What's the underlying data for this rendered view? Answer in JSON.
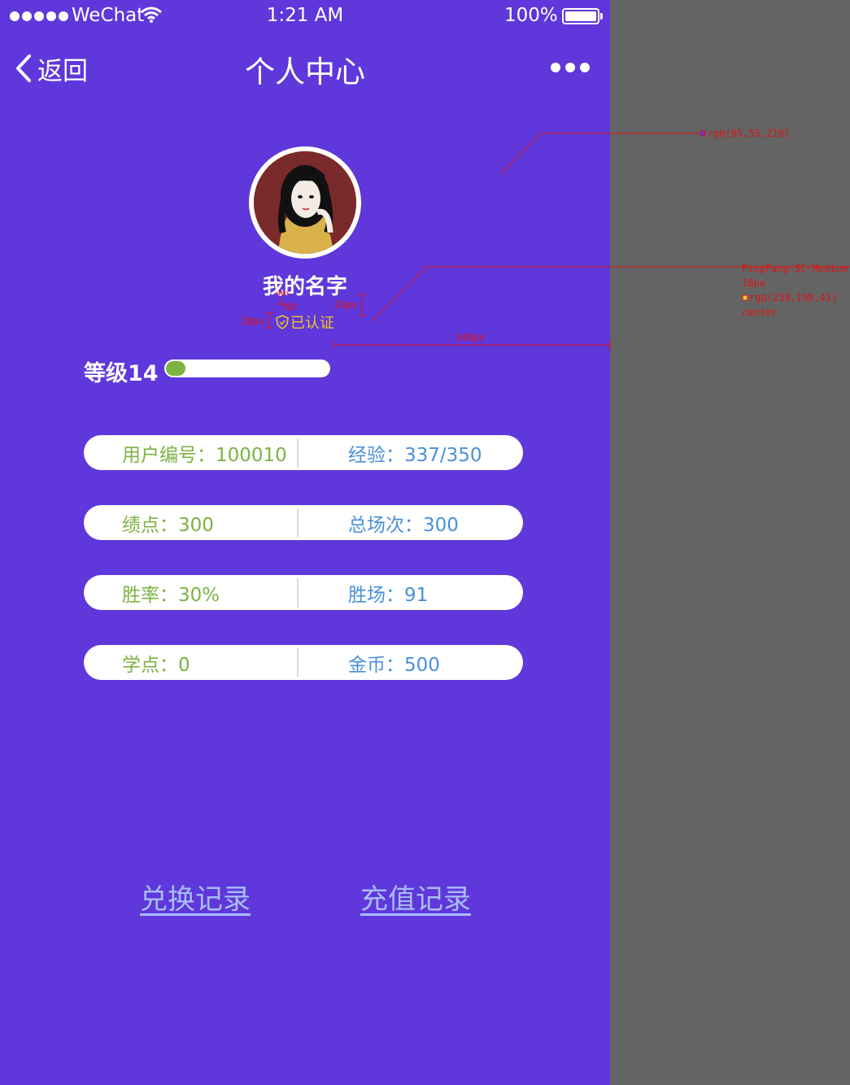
{
  "status_bar": {
    "carrier": "WeChat",
    "time": "1:21 AM",
    "battery": "100%"
  },
  "nav": {
    "back_label": "返回",
    "title": "个人中心"
  },
  "profile": {
    "name": "我的名字",
    "verified_label": "已认证"
  },
  "level": {
    "label": "等级14",
    "progress": 0.12
  },
  "stats": [
    {
      "left": "用户编号：100010",
      "right": "经验：337/350"
    },
    {
      "left": "绩点：300",
      "right": "总场次：300"
    },
    {
      "left": "胜率：30%",
      "right": "胜场：91"
    },
    {
      "left": "学点：0",
      "right": "金币：500"
    }
  ],
  "footer": {
    "exchange_label": "兑换记录",
    "recharge_label": "充值记录"
  },
  "colors": {
    "background": "#5f37db",
    "accent_gold": "#efc729",
    "green": "#7cb342",
    "blue": "#4a90d9"
  },
  "annotations": {
    "bg_color": "rgb(95,55,219)",
    "font_spec": [
      "PingFang-SC-Medium",
      "18px",
      "rgb(239,199,41)",
      "center"
    ],
    "dim_1": "18px",
    "dim_2": "24px",
    "dim_3": "340px",
    "dim_4": "4px",
    "dim_5": "4px"
  }
}
